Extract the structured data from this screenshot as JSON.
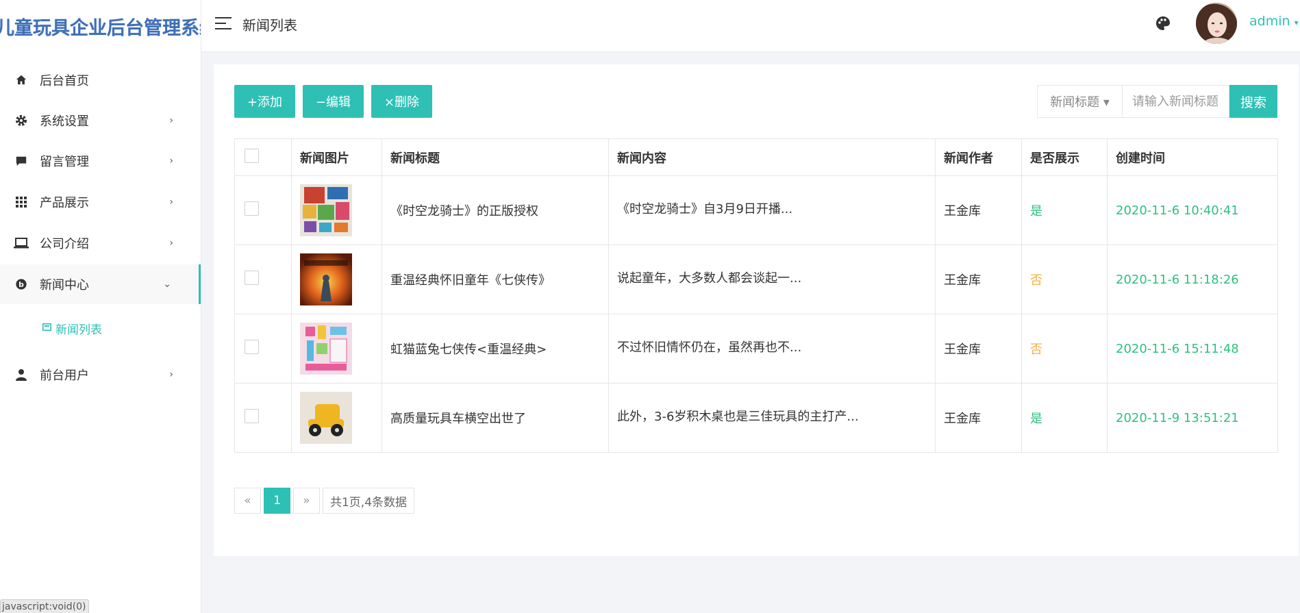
{
  "app": {
    "brand": "儿童玩具企业后台管理系统",
    "statusbar": "javascript:void(0)"
  },
  "header": {
    "title": "新闻列表",
    "username": "admin"
  },
  "sidebar": {
    "items": [
      {
        "label": "后台首页",
        "icon": "home-icon"
      },
      {
        "label": "系统设置",
        "icon": "gear-icon",
        "arrow": "›"
      },
      {
        "label": "留言管理",
        "icon": "message-icon",
        "arrow": "›"
      },
      {
        "label": "产品展示",
        "icon": "grid-icon",
        "arrow": "›"
      },
      {
        "label": "公司介绍",
        "icon": "laptop-icon",
        "arrow": "›"
      },
      {
        "label": "新闻中心",
        "icon": "news-icon",
        "arrow": "⌄"
      },
      {
        "label": "前台用户",
        "icon": "user-icon",
        "arrow": "›"
      }
    ],
    "subitem": {
      "label": "新闻列表"
    }
  },
  "toolbar": {
    "add": "+添加",
    "edit": "−编辑",
    "delete": "×删除"
  },
  "search": {
    "field": "新闻标题 ▾",
    "placeholder": "请输入新闻标题",
    "button": "搜索"
  },
  "table": {
    "headers": [
      "新闻图片",
      "新闻标题",
      "新闻内容",
      "新闻作者",
      "是否展示",
      "创建时间"
    ],
    "rows": [
      {
        "title": "《时空龙骑士》的正版授权",
        "content": "《时空龙骑士》自3月9日开播...",
        "author": "王金库",
        "show": "是",
        "time": "2020-11-6 10:40:41"
      },
      {
        "title": "重温经典怀旧童年《七侠传》",
        "content": "说起童年，大多数人都会谈起一...",
        "author": "王金库",
        "show": "否",
        "time": "2020-11-6 11:18:26"
      },
      {
        "title": "虹猫蓝兔七侠传<重温经典>",
        "content": "不过怀旧情怀仍在，虽然再也不...",
        "author": "王金库",
        "show": "否",
        "time": "2020-11-6 15:11:48"
      },
      {
        "title": "高质量玩具车横空出世了",
        "content": "此外，3-6岁积木桌也是三佳玩具的主打产...",
        "author": "王金库",
        "show": "是",
        "time": "2020-11-9 13:51:21"
      }
    ]
  },
  "pagination": {
    "prev": "«",
    "current": "1",
    "next": "»",
    "info": "共1页,4条数据"
  },
  "colors": {
    "accent": "#2ec0b5",
    "yes": "#2ec07f",
    "no": "#f5b042",
    "brand": "#3f6fb6"
  }
}
